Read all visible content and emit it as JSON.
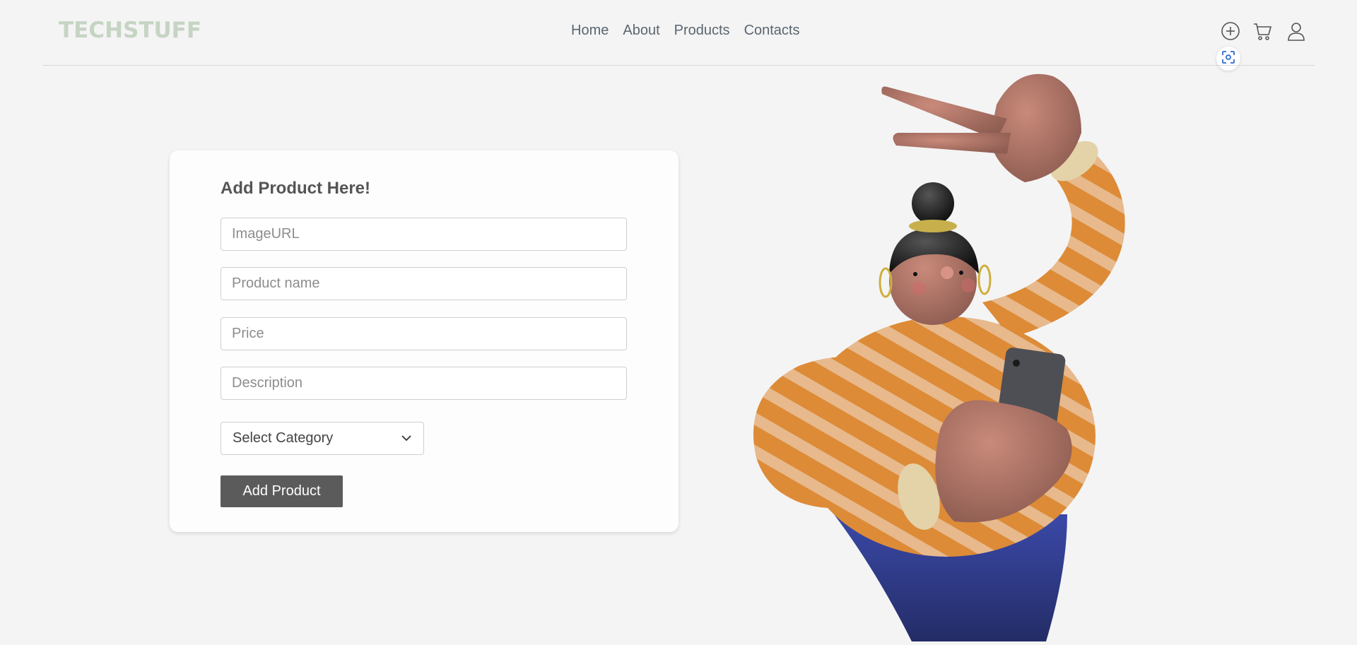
{
  "header": {
    "logo": "TECHSTUFF",
    "nav": [
      "Home",
      "About",
      "Products",
      "Contacts"
    ],
    "icons": [
      "add-circle-icon",
      "cart-icon",
      "user-icon",
      "screen-capture-icon"
    ]
  },
  "form": {
    "title": "Add Product Here!",
    "image_url_placeholder": "ImageURL",
    "product_name_placeholder": "Product name",
    "price_placeholder": "Price",
    "description_placeholder": "Description",
    "category_selected": "Select Category",
    "submit_label": "Add Product"
  },
  "colors": {
    "background": "#f4f4f4",
    "logo": "#c6d4c4",
    "button": "#5b5b5b",
    "nav_text": "#5a6670"
  },
  "hero": {
    "description_icon": "3d-character-illustration"
  }
}
